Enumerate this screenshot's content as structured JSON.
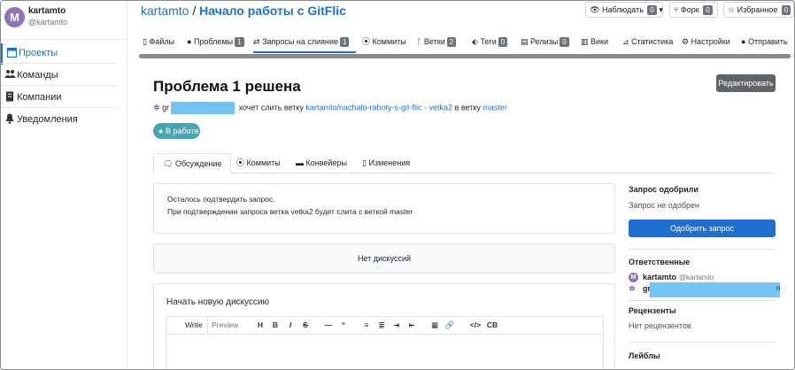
{
  "sidebar": {
    "user": {
      "avatar_letter": "M",
      "name": "kartamto",
      "login": "@kartamto"
    },
    "items": [
      {
        "label": "Проекты",
        "icon": "folder-icon",
        "active": true
      },
      {
        "label": "Команды",
        "icon": "users-icon"
      },
      {
        "label": "Компании",
        "icon": "building-icon"
      },
      {
        "label": "Уведомления",
        "icon": "bell-icon"
      }
    ]
  },
  "header": {
    "owner": "kartamto",
    "separator": "/",
    "project": "Начало работы с GitFlic",
    "watch": {
      "label": "Наблюдать",
      "count": "0"
    },
    "fork": {
      "label": "Форк",
      "count": "0"
    },
    "favorite": {
      "label": "Избранное",
      "count": "0"
    }
  },
  "tabs": [
    {
      "label": "Файлы",
      "icon": "file-icon"
    },
    {
      "label": "Проблемы",
      "icon": "issue-icon",
      "count": "1"
    },
    {
      "label": "Запросы на слияние",
      "icon": "merge-icon",
      "count": "1",
      "active": true
    },
    {
      "label": "Коммиты",
      "icon": "commit-icon"
    },
    {
      "label": "Ветки",
      "icon": "branch-icon",
      "count": "2"
    },
    {
      "label": "Теги",
      "icon": "tag-icon",
      "count": "0"
    },
    {
      "label": "Релизы",
      "icon": "release-icon",
      "count": "0"
    },
    {
      "label": "Вики",
      "icon": "book-icon"
    },
    {
      "label": "Статистика",
      "icon": "chart-icon"
    },
    {
      "label": "Настройки",
      "icon": "gear-icon"
    },
    {
      "label": "Отправить",
      "icon": "info-icon"
    }
  ],
  "mr": {
    "title": "Проблема 1 решена",
    "edit_label": "Редактировать",
    "author_prefix": "gr",
    "wants_merge": "хочет слить ветку",
    "source_branch": "kartamto/nachalo-raboty-s-git-flic - vetka2",
    "into": "в ветку",
    "target_branch": "master",
    "state": "В работе"
  },
  "discussion_tabs": [
    {
      "label": "Обсуждение",
      "icon": "comments-icon",
      "active": true
    },
    {
      "label": "Коммиты",
      "icon": "commit-icon"
    },
    {
      "label": "Конвейеры",
      "icon": "pipeline-icon"
    },
    {
      "label": "Изменения",
      "icon": "diff-icon"
    }
  ],
  "notice": {
    "line1": "Осталось подтвердить запрос.",
    "line2": "При подтверждении запроса ветка vetka2 будет слита с веткой master"
  },
  "no_discussions": "Нет дискуссий",
  "new_discussion": {
    "heading": "Начать новую дискуссию",
    "write_tab": "Write",
    "preview_tab": "Preview",
    "toolbar": [
      "H",
      "B",
      "I",
      "S",
      "—",
      "“",
      "≡",
      "≣",
      "⇥",
      "⇤",
      "▦",
      "🔗",
      "</>",
      "CB"
    ]
  },
  "right": {
    "approved_heading": "Запрос одобрили",
    "approved_text": "Запрос не одобрен",
    "approve_button": "Одобрить запрос",
    "assignees_heading": "Ответственные",
    "assignee1": {
      "avatar_letter": "M",
      "name": "kartamto",
      "login": "@kartamto"
    },
    "assignee2_prefix": "gr",
    "assignee2_suffix": "n",
    "reviewers_heading": "Рецензенты",
    "reviewers_text": "Нет рецензентов",
    "labels_heading": "Лейблы"
  },
  "colors": {
    "accent": "#1f6fd1",
    "badge": "#45a5b4",
    "redaction": "#74c3f5",
    "avatar": "#8e74b8"
  }
}
